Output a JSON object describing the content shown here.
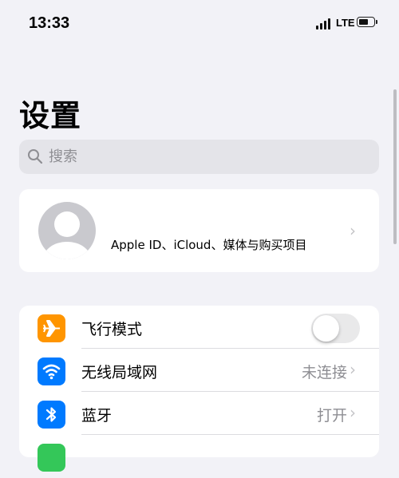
{
  "status_bar": {
    "time": "13:33",
    "network": "LTE"
  },
  "header": {
    "title": "设置"
  },
  "search": {
    "placeholder": "搜索"
  },
  "apple_id": {
    "label": "Apple ID、iCloud、媒体与购买项目"
  },
  "settings": [
    {
      "label": "飞行模式",
      "icon": "airplane-icon",
      "color": "#ff9500",
      "toggle": false
    },
    {
      "label": "无线局域网",
      "icon": "wifi-icon",
      "color": "#007aff",
      "value": "未连接"
    },
    {
      "label": "蓝牙",
      "icon": "bluetooth-icon",
      "color": "#007aff",
      "value": "打开"
    }
  ],
  "colors": {
    "background": "#f2f2f7",
    "secondary_text": "#8e8e93"
  }
}
